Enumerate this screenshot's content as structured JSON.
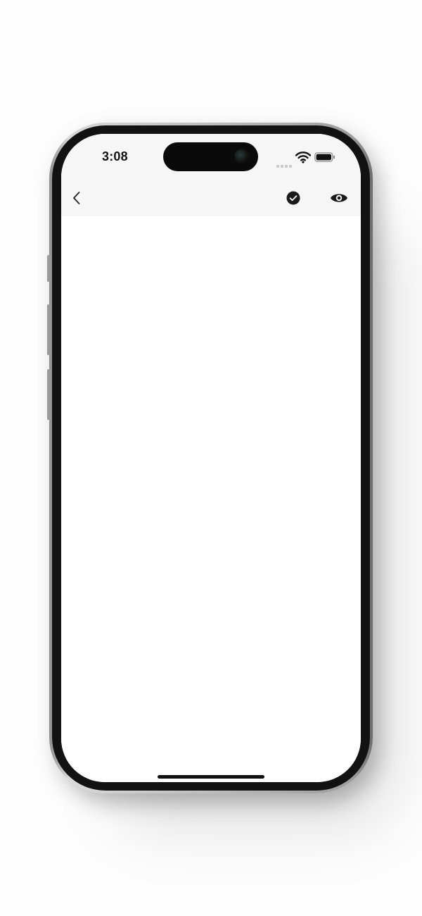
{
  "status_bar": {
    "time": "3:08",
    "icons": [
      "cellular-signal-icon",
      "wifi-icon",
      "battery-icon"
    ]
  },
  "nav_bar": {
    "left_icon": "chevron-left-icon",
    "right_icons": [
      "checkmark-circle-icon",
      "eye-icon"
    ]
  },
  "colors": {
    "header_background": "#f6f6f6",
    "screen_background": "#ffffff",
    "icon_color": "#1a1a1a",
    "frame_color": "#121212"
  }
}
